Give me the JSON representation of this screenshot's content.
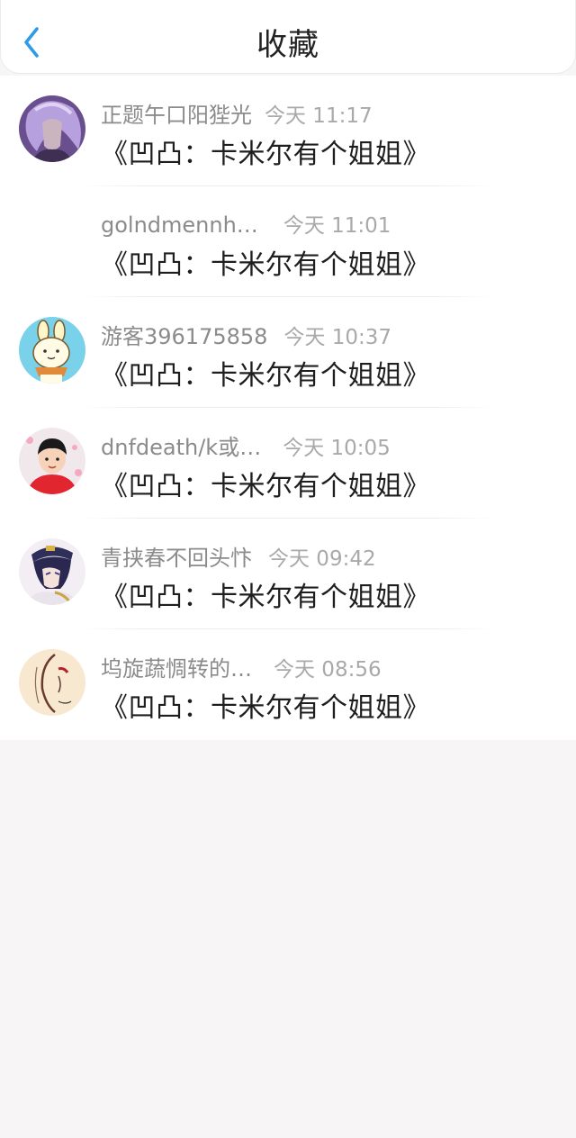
{
  "header": {
    "title": "收藏",
    "back_icon": "chevron-left-icon",
    "accent_color": "#2f9be6"
  },
  "items": [
    {
      "user": "正题午口阳狴光",
      "time": "今天 11:17",
      "text": "《凹凸：卡米尔有个姐姐》",
      "avatar": "purple-hair-character"
    },
    {
      "user": "golndmennh…",
      "time": "今天 11:01",
      "text": "《凹凸：卡米尔有个姐姐》",
      "avatar": "none"
    },
    {
      "user": "游客396175858",
      "time": "今天 10:37",
      "text": "《凹凸：卡米尔有个姐姐》",
      "avatar": "cartoon-bunny"
    },
    {
      "user": "dnfdeath/k或…",
      "time": "今天 10:05",
      "text": "《凹凸：卡米尔有个姐姐》",
      "avatar": "child-photo"
    },
    {
      "user": "青挟春不回头忭",
      "time": "今天 09:42",
      "text": "《凹凸：卡米尔有个姐姐》",
      "avatar": "anime-boy-cap"
    },
    {
      "user": "坞旋蔬惆转的…",
      "time": "今天 08:56",
      "text": "《凹凸：卡米尔有个姐姐》",
      "avatar": "sketch-portrait"
    }
  ]
}
